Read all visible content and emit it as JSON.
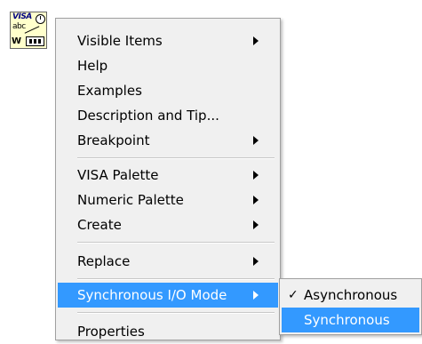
{
  "node_icon": {
    "line1": "VISA",
    "line2": "abc",
    "line3": "W"
  },
  "menu": {
    "items": [
      {
        "label": "Visible Items",
        "submenu": true
      },
      {
        "label": "Help",
        "submenu": false
      },
      {
        "label": "Examples",
        "submenu": false
      },
      {
        "label": "Description and Tip...",
        "submenu": false
      },
      {
        "label": "Breakpoint",
        "submenu": true
      },
      {
        "label": "VISA Palette",
        "submenu": true
      },
      {
        "label": "Numeric Palette",
        "submenu": true
      },
      {
        "label": "Create",
        "submenu": true
      },
      {
        "label": "Replace",
        "submenu": true
      },
      {
        "label": "Synchronous I/O Mode",
        "submenu": true,
        "highlighted": true
      },
      {
        "label": "Properties",
        "submenu": false
      }
    ]
  },
  "submenu": {
    "items": [
      {
        "label": "Asynchronous",
        "checked": true,
        "check_glyph": "✓"
      },
      {
        "label": "Synchronous",
        "highlighted": true
      }
    ]
  },
  "colors": {
    "highlight": "#3399ff",
    "menu_bg": "#f0f0f0"
  }
}
